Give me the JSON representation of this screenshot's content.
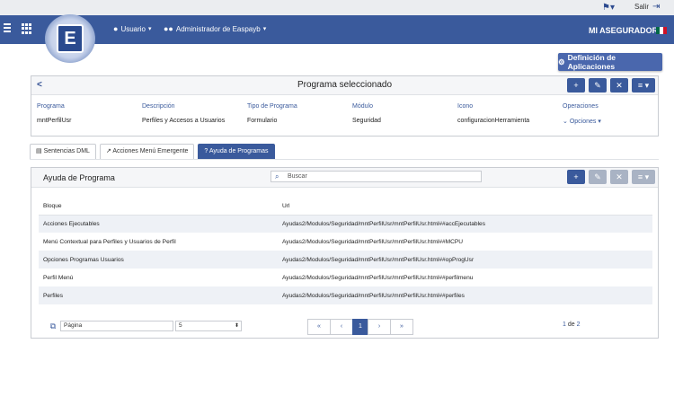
{
  "topbar": {
    "flag_icon": "flag-icon",
    "logout_label": "Salir",
    "exit_icon": "exit-icon"
  },
  "navbar": {
    "menu_icon": "hamburger-icon",
    "apps_icon": "grid-icon",
    "logo_letter": "E",
    "user_label": "Usuario",
    "admin_label": "Administrador de Easpayb",
    "company": "MI ASEGURADORA",
    "flag_colors": [
      "#006847",
      "#ffffff",
      "#ce1126"
    ]
  },
  "definition_button": "Definición de Aplicaciones",
  "program_panel": {
    "title": "Programa seleccionado",
    "columns": [
      {
        "header": "Programa",
        "value": "mntPerfilUsr"
      },
      {
        "header": "Descripción",
        "value": "Perfiles y Accesos a Usuarios"
      },
      {
        "header": "Tipo de Programa",
        "value": "Formulario"
      },
      {
        "header": "Módulo",
        "value": "Seguridad"
      },
      {
        "header": "Icono",
        "value": "configuracionHerramienta"
      },
      {
        "header": "Operaciones",
        "value": "Opciones"
      }
    ]
  },
  "tabs": [
    {
      "label": "Sentencias DML",
      "icon": "document-icon"
    },
    {
      "label": "Acciones Menú Emergente",
      "icon": "cursor-icon"
    },
    {
      "label": "Ayuda de Programas",
      "icon": "question-icon"
    }
  ],
  "help_panel": {
    "title": "Ayuda de Programa",
    "search_placeholder": "Buscar",
    "headers": [
      "Bloque",
      "Url"
    ],
    "rows": [
      [
        "Acciones Ejecutables",
        "Ayudas2/Modulos/Seguridad/mntPerfilUsr/mntPerfilUsr.html##accEjecutables"
      ],
      [
        "Menú Contextual para Perfiles y Usuarios de Perfil",
        "Ayudas2/Modulos/Seguridad/mntPerfilUsr/mntPerfilUsr.html##MCPU"
      ],
      [
        "Opciones Programas Usuarios",
        "Ayudas2/Modulos/Seguridad/mntPerfilUsr/mntPerfilUsr.html##opProgUsr"
      ],
      [
        "Perfil Menú",
        "Ayudas2/Modulos/Seguridad/mntPerfilUsr/mntPerfilUsr.html##perfilmenu"
      ],
      [
        "Perfiles",
        "Ayudas2/Modulos/Seguridad/mntPerfilUsr/mntPerfilUsr.html##perfiles"
      ]
    ]
  },
  "pager": {
    "page_placeholder": "Página",
    "page_size": "5",
    "first": "«",
    "prev": "‹",
    "current": "1",
    "next": "›",
    "last": "»",
    "current_page": "1",
    "of_label": "de",
    "total_pages": "2"
  },
  "colors": {
    "primary": "#3a5a9c",
    "accent_button": "#4a67ad",
    "disabled": "#a9b3c4",
    "row_alt": "#eef1f6"
  }
}
